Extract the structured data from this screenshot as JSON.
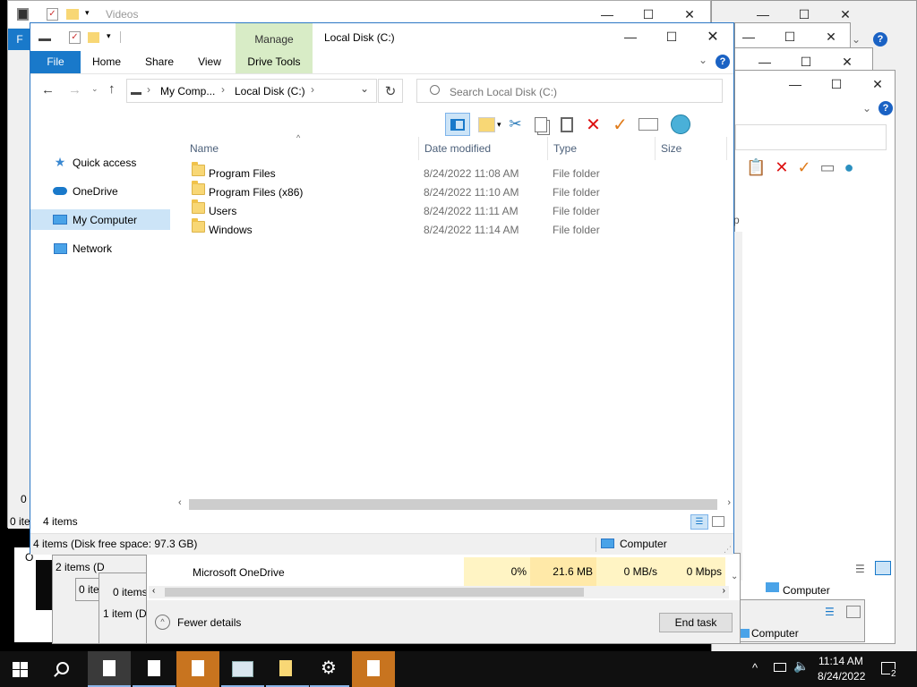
{
  "windows_bg": {
    "videos_title": "Videos",
    "tm_app_name": "Microsoft OneDrive",
    "tm_cpu": "0%",
    "tm_mem": "21.6 MB",
    "tm_disk": "0 MB/s",
    "tm_net": "0 Mbps",
    "tm_fewer_details": "Fewer details",
    "tm_end_task": "End task",
    "items_2": "2 items (D",
    "items_0a": "0 ite",
    "items_0b": "0 items",
    "items_1": "1 item (D",
    "left_0i": "0 i",
    "left_0it": "0 ite",
    "left_O": "O",
    "right_computer1": "Computer",
    "right_computer2": "Computer",
    "left_F": "F",
    "left_p": "p"
  },
  "main": {
    "title": "Local Disk (C:)",
    "manage_label": "Manage",
    "tabs": [
      "File",
      "Home",
      "Share",
      "View",
      "Drive Tools"
    ],
    "breadcrumb": [
      "My Comp...",
      "Local Disk (C:)"
    ],
    "search_placeholder": "Search Local Disk (C:)",
    "nav": [
      "Quick access",
      "OneDrive",
      "My Computer",
      "Network"
    ],
    "columns": [
      "Name",
      "Date modified",
      "Type",
      "Size"
    ],
    "rows": [
      {
        "name": "Program Files",
        "date": "8/24/2022 11:08 AM",
        "type": "File folder"
      },
      {
        "name": "Program Files (x86)",
        "date": "8/24/2022 11:10 AM",
        "type": "File folder"
      },
      {
        "name": "Users",
        "date": "8/24/2022 11:11 AM",
        "type": "File folder"
      },
      {
        "name": "Windows",
        "date": "8/24/2022 11:14 AM",
        "type": "File folder"
      }
    ],
    "items_count": "4 items",
    "status_left": "4 items (Disk free space: 97.3 GB)",
    "status_right": "Computer"
  },
  "taskbar": {
    "time": "11:14 AM",
    "date": "8/24/2022",
    "notif_count": "2"
  },
  "colors": {
    "accent": "#1979ca",
    "manage_tab": "#d8ecc6",
    "selection": "#cce4f7",
    "tm_highlight": "#fff4c4",
    "taskbar": "#101010",
    "taskbar_active": "#c8741f"
  }
}
